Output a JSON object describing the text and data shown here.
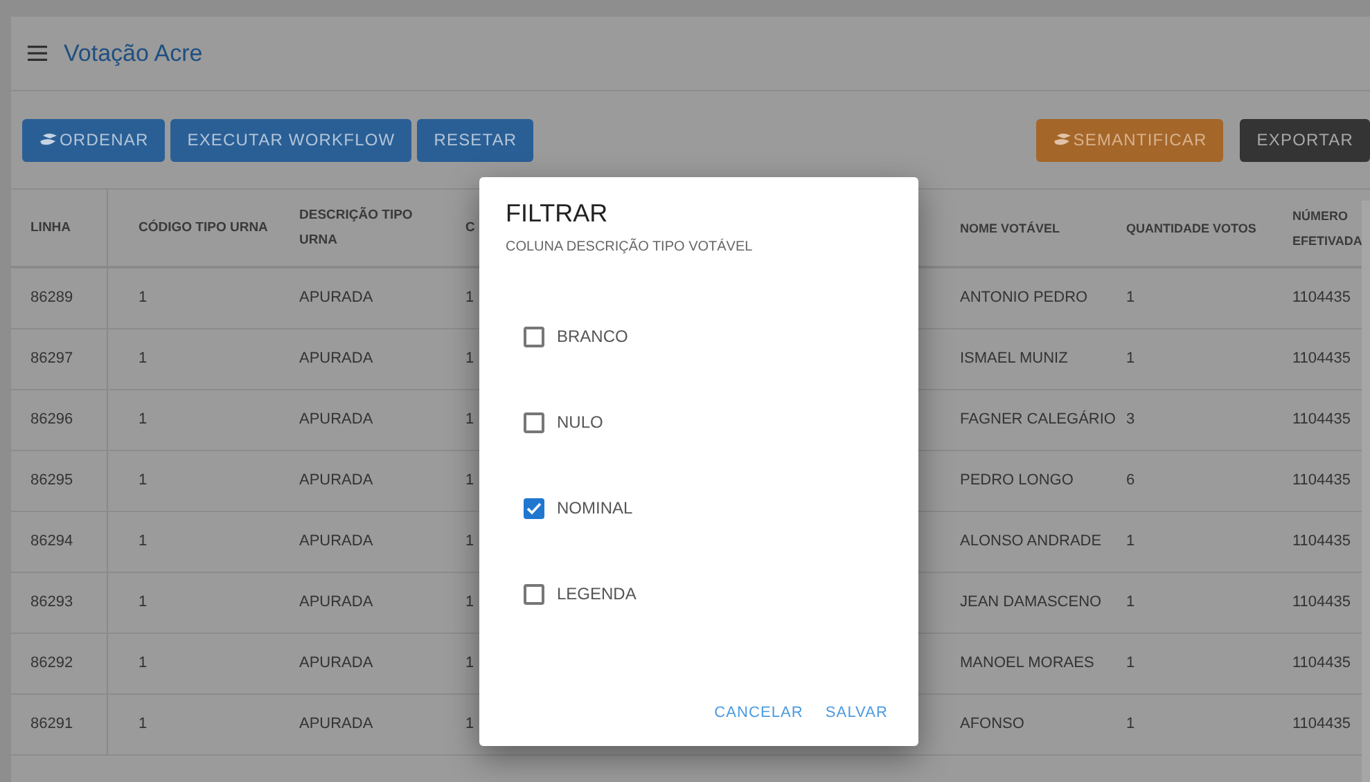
{
  "header": {
    "title": "Votação Acre"
  },
  "toolbar_left": [
    {
      "label": "ORDENAR",
      "icon": true
    },
    {
      "label": "EXECUTAR WORKFLOW",
      "icon": false
    },
    {
      "label": "RESETAR",
      "icon": false
    }
  ],
  "toolbar_right": [
    {
      "label": "SEMANTIFICAR",
      "kind": "accent",
      "icon": true
    },
    {
      "label": "EXPORTAR",
      "kind": "dark",
      "icon": false
    }
  ],
  "table": {
    "columns_left": [
      "LINHA",
      "CÓDIGO TIPO URNA",
      "DESCRIÇÃO TIPO URNA",
      "C"
    ],
    "columns_right": [
      "NOME VOTÁVEL",
      "QUANTIDADE VOTOS",
      "NÚMERO EFETIVADA"
    ],
    "rows": [
      {
        "left_cells": [
          "86289",
          "1",
          "APURADA",
          "1"
        ],
        "right_cells": [
          "ANTONIO PEDRO",
          "1",
          "1104435"
        ]
      },
      {
        "left_cells": [
          "86297",
          "1",
          "APURADA",
          "1"
        ],
        "right_cells": [
          "ISMAEL MUNIZ",
          "1",
          "1104435"
        ]
      },
      {
        "left_cells": [
          "86296",
          "1",
          "APURADA",
          "1"
        ],
        "right_cells": [
          "FAGNER CALEGÁRIO",
          "3",
          "1104435"
        ]
      },
      {
        "left_cells": [
          "86295",
          "1",
          "APURADA",
          "1"
        ],
        "right_cells": [
          "PEDRO LONGO",
          "6",
          "1104435"
        ]
      },
      {
        "left_cells": [
          "86294",
          "1",
          "APURADA",
          "1"
        ],
        "right_cells": [
          "ALONSO ANDRADE",
          "1",
          "1104435"
        ]
      },
      {
        "left_cells": [
          "86293",
          "1",
          "APURADA",
          "1"
        ],
        "right_cells": [
          "JEAN DAMASCENO",
          "1",
          "1104435"
        ]
      },
      {
        "left_cells": [
          "86292",
          "1",
          "APURADA",
          "1"
        ],
        "right_cells": [
          "MANOEL MORAES",
          "1",
          "1104435"
        ]
      },
      {
        "left_cells": [
          "86291",
          "1",
          "APURADA",
          "1"
        ],
        "right_cells": [
          "AFONSO",
          "1",
          "1104435"
        ]
      }
    ]
  },
  "dialog": {
    "title": "FILTRAR",
    "subtitle": "COLUNA DESCRIÇÃO TIPO VOTÁVEL",
    "options": [
      {
        "label": "BRANCO",
        "checked": false
      },
      {
        "label": "NULO",
        "checked": false
      },
      {
        "label": "NOMINAL",
        "checked": true
      },
      {
        "label": "LEGENDA",
        "checked": false
      }
    ],
    "actions": [
      "CANCELAR",
      "SALVAR"
    ]
  }
}
